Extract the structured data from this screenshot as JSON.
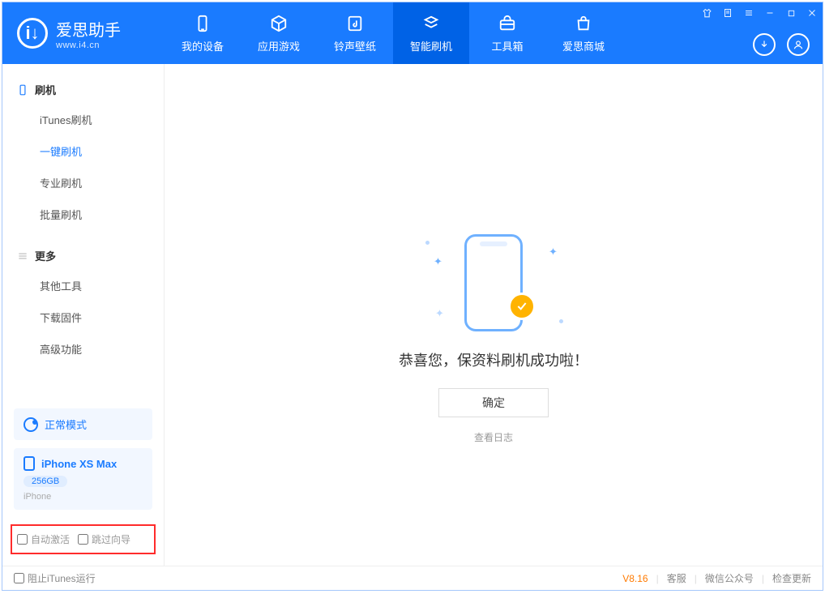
{
  "brand": {
    "name": "爱思助手",
    "url": "www.i4.cn"
  },
  "nav": [
    {
      "label": "我的设备",
      "icon": "device"
    },
    {
      "label": "应用游戏",
      "icon": "cube"
    },
    {
      "label": "铃声壁纸",
      "icon": "music"
    },
    {
      "label": "智能刷机",
      "icon": "refresh",
      "active": true
    },
    {
      "label": "工具箱",
      "icon": "toolbox"
    },
    {
      "label": "爱思商城",
      "icon": "bag"
    }
  ],
  "sidebar": {
    "group1": {
      "title": "刷机",
      "items": [
        "iTunes刷机",
        "一键刷机",
        "专业刷机",
        "批量刷机"
      ],
      "activeIndex": 1
    },
    "group2": {
      "title": "更多",
      "items": [
        "其他工具",
        "下载固件",
        "高级功能"
      ]
    }
  },
  "mode": {
    "label": "正常模式"
  },
  "device": {
    "name": "iPhone XS Max",
    "capacity": "256GB",
    "platform": "iPhone"
  },
  "options": {
    "auto_activate": "自动激活",
    "skip_guide": "跳过向导"
  },
  "main": {
    "success": "恭喜您，保资料刷机成功啦！",
    "ok": "确定",
    "view_log": "查看日志"
  },
  "status": {
    "block_itunes": "阻止iTunes运行",
    "version": "V8.16",
    "links": [
      "客服",
      "微信公众号",
      "检查更新"
    ]
  }
}
